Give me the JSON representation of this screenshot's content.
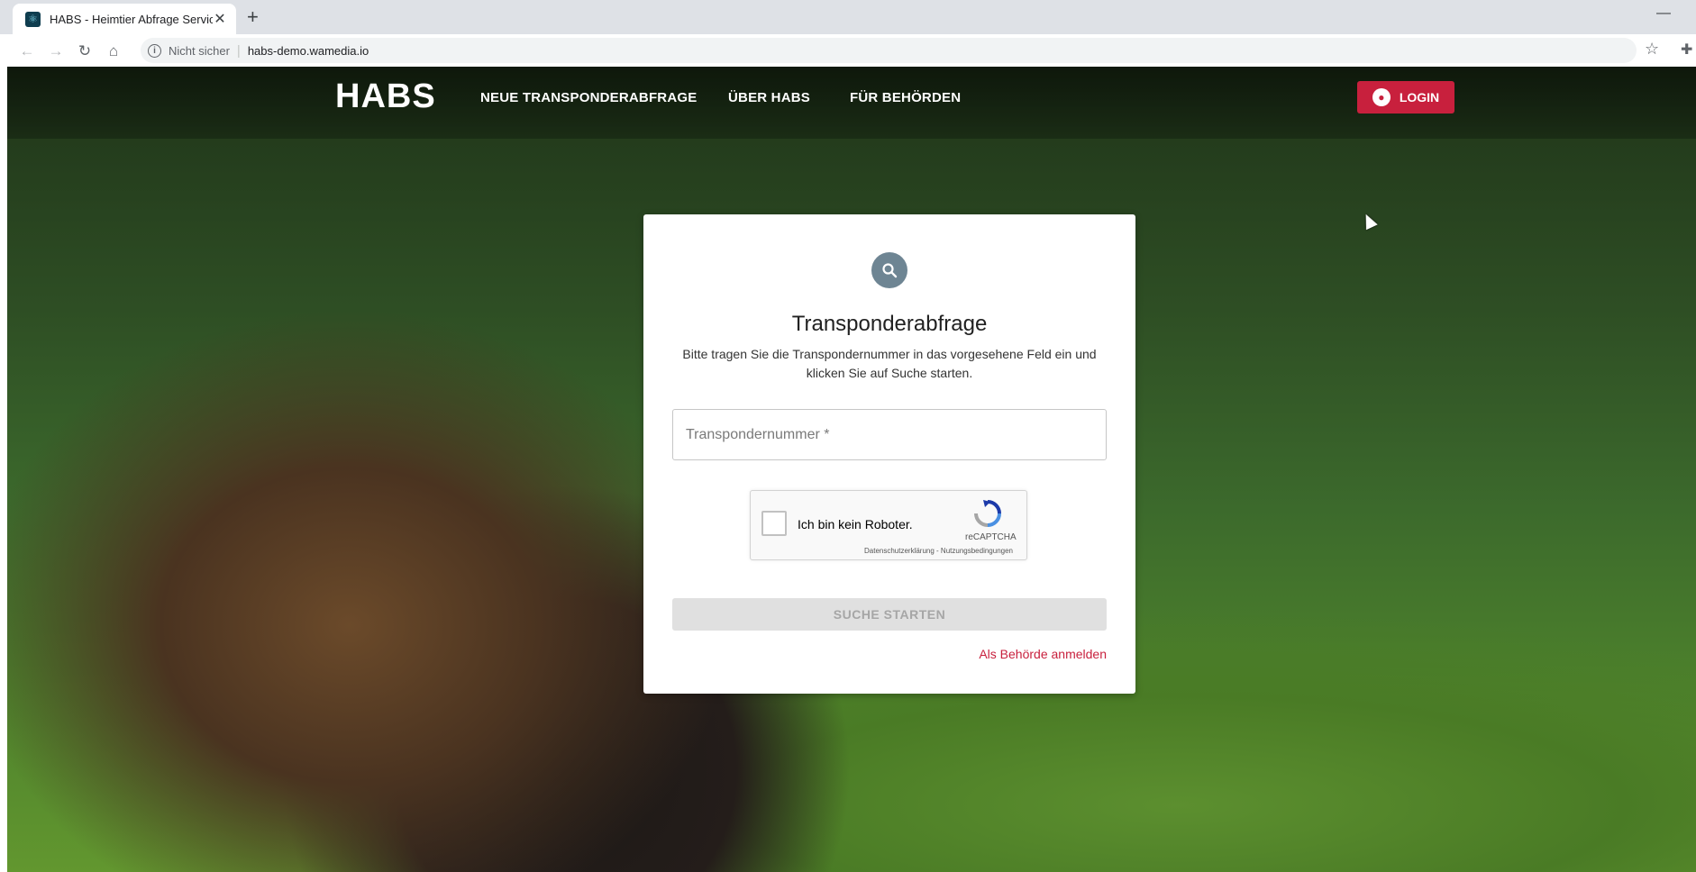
{
  "browser": {
    "tab_title": "HABS - Heimtier Abfrage Service",
    "tab_close": "✕",
    "new_tab": "+",
    "minimize": "—",
    "security_label": "Nicht sicher",
    "url": "habs-demo.wamedia.io"
  },
  "header": {
    "logo": "HABS",
    "menu": [
      {
        "label": "NEUE TRANSPONDERABFRAGE"
      },
      {
        "label": "ÜBER HABS"
      },
      {
        "label": "FÜR BEHÖRDEN"
      }
    ],
    "login_label": "LOGIN"
  },
  "card": {
    "title": "Transponderabfrage",
    "description_line1": "Bitte tragen Sie die Transpondernummer in das vorgesehene Feld ein und",
    "description_line2": "klicken Sie auf Suche starten.",
    "input_placeholder": "Transpondernummer *",
    "input_value": "",
    "captcha_label": "Ich bin kein Roboter.",
    "captcha_brand": "reCAPTCHA",
    "captcha_links": "Datenschutzerklärung - Nutzungsbedingungen",
    "submit_label": "SUCHE STARTEN",
    "authority_link": "Als Behörde anmelden"
  },
  "colors": {
    "accent": "#c8203d",
    "icon_circle": "#6e8593",
    "disabled_button": "#e0e0e0"
  },
  "icons": {
    "favicon": "react-atom-icon",
    "back": "arrow-left-icon",
    "forward": "arrow-right-icon",
    "reload": "reload-icon",
    "home": "home-icon",
    "info": "info-icon",
    "bookmark": "star-icon",
    "extensions": "puzzle-icon",
    "login": "account-circle-icon",
    "search": "search-icon"
  }
}
